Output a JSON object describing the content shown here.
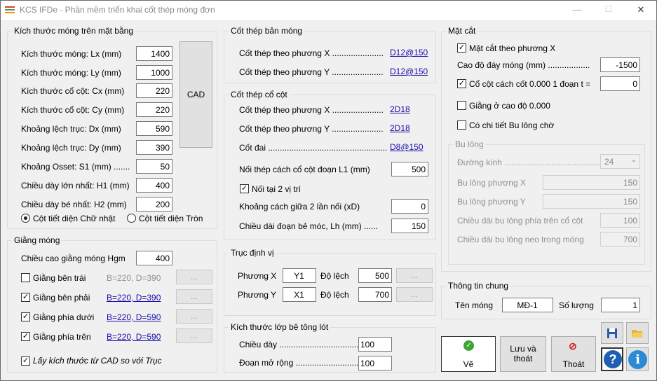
{
  "window": {
    "title": "KCS IFDe - Phần mềm triển khai cốt thép móng đơn",
    "min": "—",
    "max": "☐",
    "close": "✕"
  },
  "mong": {
    "caption": "Kích thước móng trên mặt bằng",
    "rows": [
      {
        "label": "Kích thước móng: Lx (mm)",
        "value": "1400"
      },
      {
        "label": "Kích thước móng: Ly (mm)",
        "value": "1000"
      },
      {
        "label": "Kích thước cổ cột: Cx (mm)",
        "value": "220"
      },
      {
        "label": "Kích thước cổ cột: Cy (mm)",
        "value": "220"
      },
      {
        "label": "Khoảng lệch trục: Dx (mm)",
        "value": "590"
      },
      {
        "label": "Khoảng lệch trục: Dy (mm)",
        "value": "390"
      },
      {
        "label": "Khoảng Osset: S1 (mm) .......",
        "value": "50"
      },
      {
        "label": "Chiều dày lớn nhất: H1 (mm)",
        "value": "400"
      },
      {
        "label": "Chiều dày bé nhất: H2 (mm)",
        "value": "200"
      }
    ],
    "cad": "CAD",
    "radio1": "Cột tiết diện Chữ nhật",
    "radio2": "Cột tiết diện Tròn"
  },
  "giang": {
    "caption": "Giằng móng",
    "hgm_label": "Chiều cao giằng móng Hgm",
    "hgm_value": "400",
    "rows": [
      {
        "label": "Giằng bên trái",
        "info": "B=220, D=390",
        "checked": false
      },
      {
        "label": "Giằng bên phải",
        "info": "B=220, D=390",
        "checked": true
      },
      {
        "label": "Giằng phía dưới",
        "info": "B=220, D=590",
        "checked": true
      },
      {
        "label": "Giằng phía trên",
        "info": "B=220, D=590",
        "checked": true
      }
    ],
    "dots": "...",
    "cad_check": "Lấy kích thước từ CAD so với Trục",
    "check_mark": "✓"
  },
  "banmong": {
    "caption": "Cốt thép bản móng",
    "x_label": "Cốt thép theo phương X ......................",
    "x_value": "D12@150",
    "y_label": "Cốt thép theo phương Y ......................",
    "y_value": "D12@150"
  },
  "cocot": {
    "caption": "Cốt thép cổ cột",
    "x_label": "Cốt thép theo phương X ......................",
    "x_value": "2D18",
    "y_label": "Cốt thép theo phương Y ......................",
    "y_value": "2D18",
    "dai_label": "Cốt   đai   ...................................................",
    "dai_value": "D8@150",
    "l1_label": "Nối thép cách cổ cột đoạn L1 (mm)",
    "l1_value": "500",
    "noi_label": "Nối tại 2 vị trí",
    "xd_label": "Khoảng cách giữa 2 lần nối (xD)",
    "xd_value": "0",
    "lh_label": "Chiều dài đoạn bẻ móc, Lh (mm) ......",
    "lh_value": "150"
  },
  "truc": {
    "caption": "Trục định vị",
    "px_label": "Phương X",
    "px_value": "Y1",
    "py_label": "Phương Y",
    "py_value": "X1",
    "dl_label": "Độ lệch",
    "dlx": "500",
    "dly": "700"
  },
  "lot": {
    "caption": "Kích thước lớp bê tông lót",
    "day_label": "Chiều  dày ......................................",
    "day_value": "100",
    "mr_label": "Đoạn mở rộng .................................",
    "mr_value": "100"
  },
  "matcat": {
    "caption": "Mặt cắt",
    "mcx_label": "Mặt cắt theo phương X",
    "cao_label": "Cao độ đáy móng (mm) ..................",
    "cao_value": "-1500",
    "co_label": "Cổ cột cách cốt 0.000 1 đoạn t =",
    "co_value": "0",
    "giang_label": "Giằng ở cao độ 0.000",
    "bulong_label": "Có chi tiết Bu lông chờ"
  },
  "bulong": {
    "caption": "Bu lông",
    "dk_label": "Đường  kính ..............................................",
    "dk_value": "24",
    "px_label": "Bu lông phương X",
    "px_value": "150",
    "py_label": "Bu lông phương Y",
    "py_value": "150",
    "tren_label": "Chiều dài bu lông phía trên cổ cột",
    "tren_value": "100",
    "neo_label": "Chiều dài bu lông neo trong móng",
    "neo_value": "700"
  },
  "chung": {
    "caption": "Thông tin chung",
    "ten_label": "Tên móng",
    "ten_value": "MĐ-1",
    "sl_label": "Số lượng",
    "sl_value": "1"
  },
  "actions": {
    "ve": "Vẽ",
    "luu_line1": "Lưu và",
    "luu_line2": "thoát",
    "thoat": "Thoát",
    "ve_icon": "✓",
    "thoat_icon": "⊘"
  },
  "colors": {
    "ve_icon": "#3fa535",
    "thoat_icon": "#d42020",
    "help": "#1e5fb4",
    "link": "#1a0dab"
  }
}
